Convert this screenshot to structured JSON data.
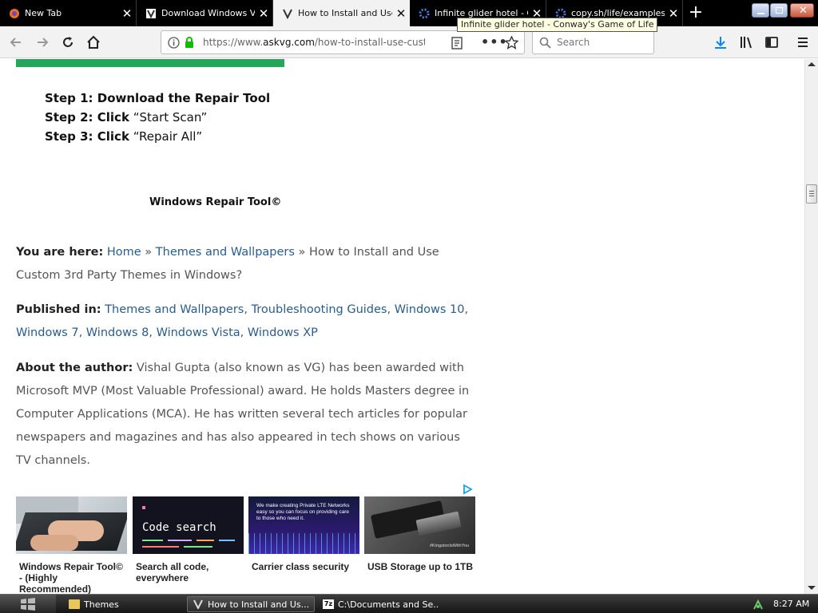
{
  "tabs": [
    {
      "title": "New Tab",
      "icon": "firefox-icon",
      "active": false
    },
    {
      "title": "Download Windows Vis",
      "icon": "askvg-icon",
      "active": false
    },
    {
      "title": "How to Install and Use",
      "icon": "askvg-icon",
      "active": true
    },
    {
      "title": "Infinite glider hotel - Co",
      "icon": "gears-icon",
      "active": false
    },
    {
      "title": "copy.sh/life/examples/",
      "icon": "gears-icon",
      "active": false
    }
  ],
  "tooltip": "Infinite glider hotel - Conway's Game of Life",
  "nav": {
    "url_prefix": "https://www.",
    "url_domain": "askvg.com",
    "url_rest": "/how-to-install-use-custo",
    "search_placeholder": "Search"
  },
  "steps": [
    {
      "label": "Step 1: Download the Repair Tool",
      "rest": ""
    },
    {
      "label": "Step 2: Click",
      "rest": " “Start Scan”"
    },
    {
      "label": "Step 3: Click",
      "rest": " “Repair All”"
    }
  ],
  "repair_caption": "Windows Repair Tool©",
  "breadcrumb": {
    "label": "You are here:",
    "home": "Home",
    "sep": " » ",
    "category": "Themes and Wallpapers",
    "current": "How to Install and Use Custom 3rd Party Themes in Windows?"
  },
  "published": {
    "label": "Published in:",
    "links": [
      "Themes and Wallpapers",
      "Troubleshooting Guides",
      "Windows 10",
      "Windows 7",
      "Windows 8",
      "Windows Vista",
      "Windows XP"
    ]
  },
  "author": {
    "label": "About the author:",
    "text": "Vishal Gupta (also known as VG) has been awarded with Microsoft MVP (Most Valuable Professional) award. He holds Masters degree in Computer Applications (MCA). He has written several tech articles for popular newspapers and magazines and has also appeared in tech shows on various TV channels."
  },
  "ads": [
    {
      "caption": "Windows Repair Tool© - (Highly Recommended)",
      "image_text": ""
    },
    {
      "caption": "Search all code, everywhere",
      "image_text": "Code search"
    },
    {
      "caption": "Carrier class security",
      "image_text": "We make creating Private LTE Networks easy so you can focus on providing care to those who need it."
    },
    {
      "caption": "USB Storage up to 1TB",
      "image_text": "#KingstonIsWithYou"
    }
  ],
  "taskbar": {
    "tasks": [
      "Themes",
      "How to Install and Us...",
      "C:\\Documents and Se..."
    ],
    "clock": "8:27 AM"
  },
  "colors": {
    "accent_green": "#26a65b",
    "link": "#2a5d8a",
    "tab_bar": "#000000"
  }
}
